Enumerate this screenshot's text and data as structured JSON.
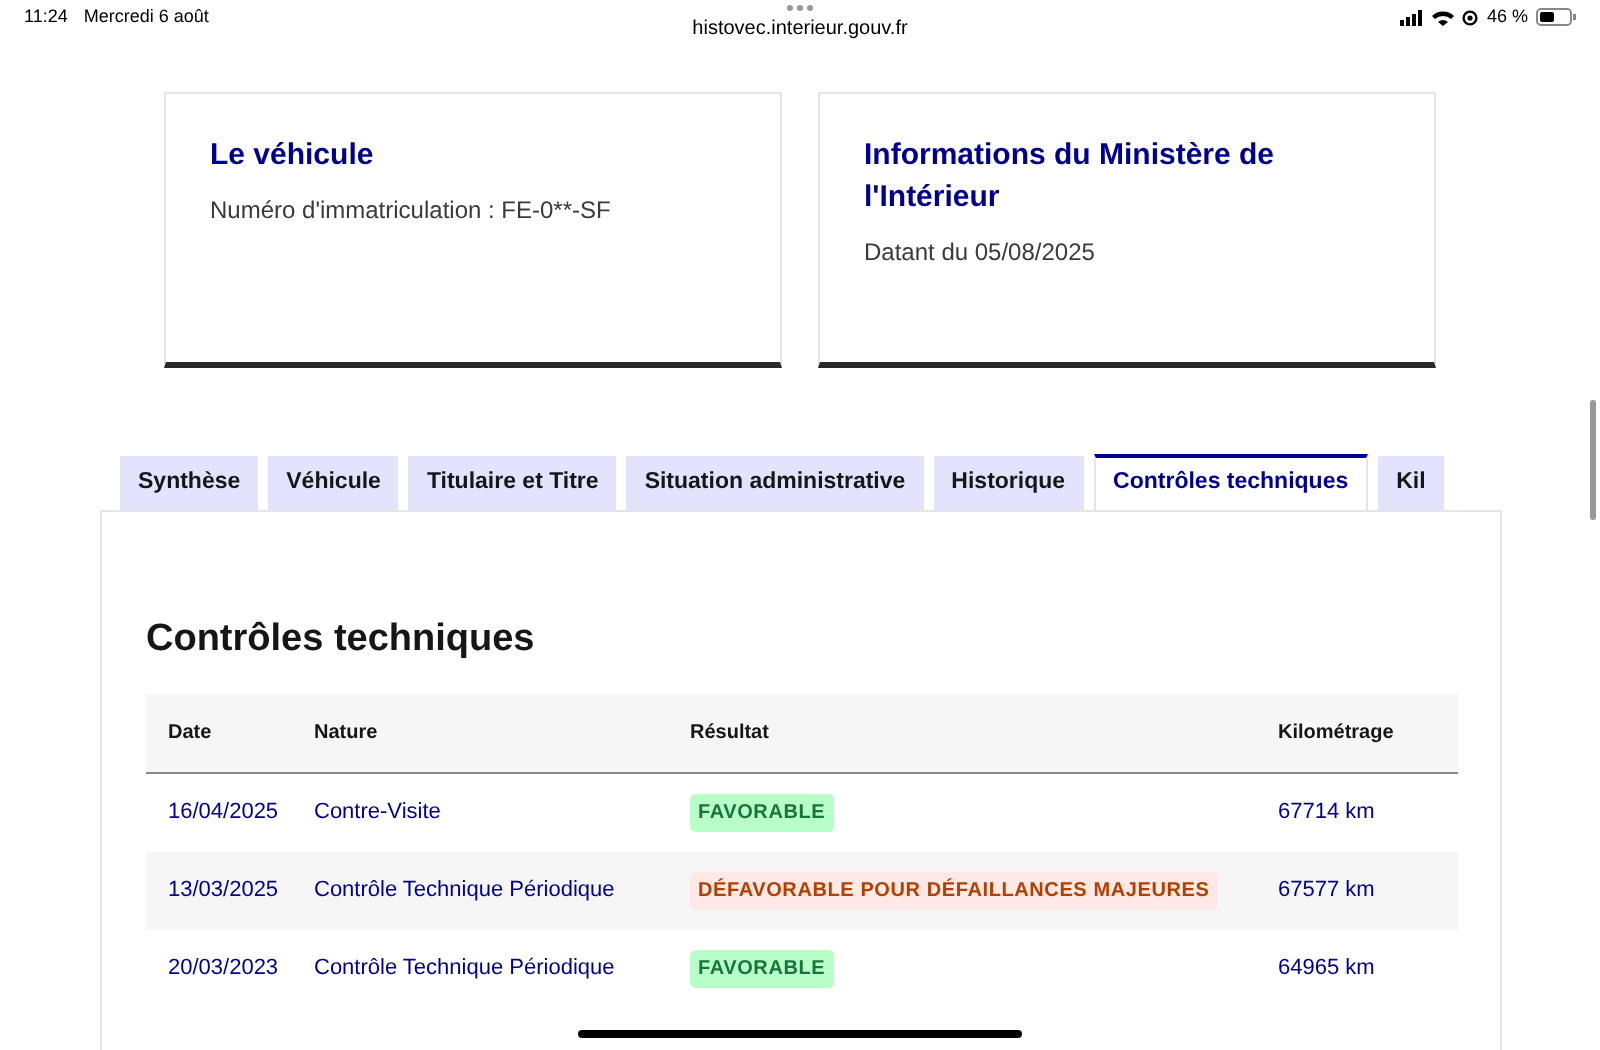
{
  "status_bar": {
    "time": "11:24",
    "date": "Mercredi 6 août",
    "url": "histovec.interieur.gouv.fr",
    "battery": "46 %"
  },
  "cards": [
    {
      "title": "Le véhicule",
      "text": "Numéro d'immatriculation : FE-0**-SF"
    },
    {
      "title": "Informations du Ministère de l'Intérieur",
      "text": "Datant du 05/08/2025"
    }
  ],
  "tabs": [
    {
      "label": "Synthèse",
      "selected": false
    },
    {
      "label": "Véhicule",
      "selected": false
    },
    {
      "label": "Titulaire et Titre",
      "selected": false
    },
    {
      "label": "Situation administrative",
      "selected": false
    },
    {
      "label": "Historique",
      "selected": false
    },
    {
      "label": "Contrôles techniques",
      "selected": true
    },
    {
      "label": "Kil",
      "selected": false
    }
  ],
  "section": {
    "title": "Contrôles techniques"
  },
  "table": {
    "columns": [
      "Date",
      "Nature",
      "Résultat",
      "Kilométrage"
    ],
    "rows": [
      {
        "date": "16/04/2025",
        "nature": "Contre-Visite",
        "result": {
          "label": "FAVORABLE",
          "kind": "success"
        },
        "mileage": "67714 km"
      },
      {
        "date": "13/03/2025",
        "nature": "Contrôle Technique Périodique",
        "result": {
          "label": "DÉFAVORABLE POUR DÉFAILLANCES MAJEURES",
          "kind": "error"
        },
        "mileage": "67577 km"
      },
      {
        "date": "20/03/2023",
        "nature": "Contrôle Technique Périodique",
        "result": {
          "label": "FAVORABLE",
          "kind": "success"
        },
        "mileage": "64965 km"
      }
    ]
  }
}
